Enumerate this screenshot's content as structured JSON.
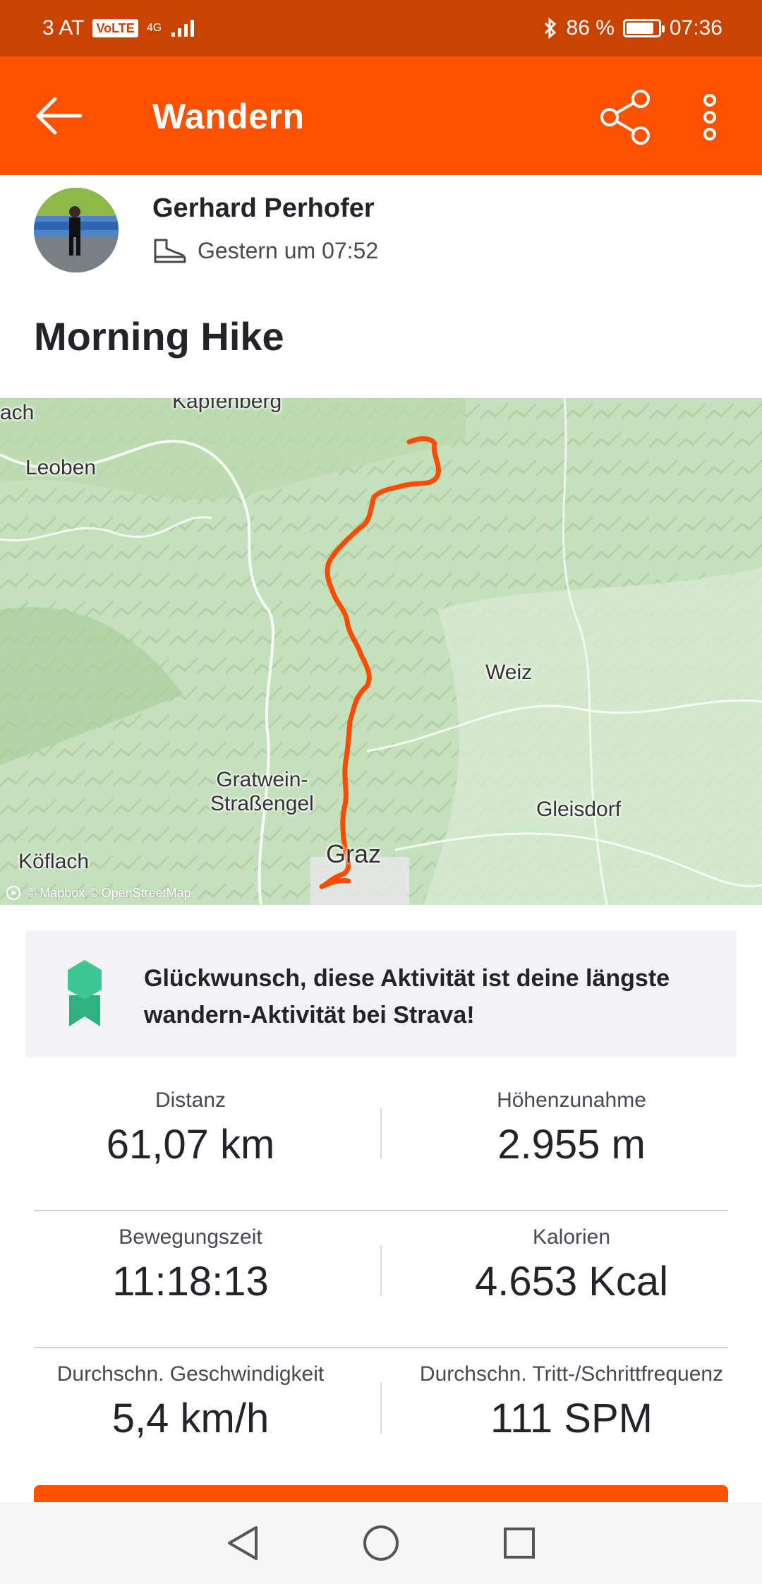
{
  "status_bar": {
    "carrier": "3 AT",
    "volte": "VoLTE",
    "network": "4G",
    "battery": "86 %",
    "battery_level": 0.86,
    "time": "07:36"
  },
  "app_bar": {
    "title": "Wandern",
    "icons": [
      "arrow-left-icon",
      "share-icon",
      "more-vertical-icon"
    ]
  },
  "athlete": {
    "name": "Gerhard Perhofer",
    "timestamp": "Gestern um 07:52",
    "sport_icon": "hiking-boot-icon"
  },
  "activity": {
    "title": "Morning Hike"
  },
  "map": {
    "labels": {
      "kapfenberg": "Kapfenberg",
      "ach": "ach",
      "leoben": "Leoben",
      "weiz": "Weiz",
      "gratwein": "Gratwein-\nStraßengel",
      "gleisdorf": "Gleisdorf",
      "koflach": "Köflach",
      "graz": "Graz"
    },
    "attribution": "© Mapbox © OpenStreetMap",
    "route_color": "#fc4c02"
  },
  "achievement": {
    "text": "Glückwunsch, diese Aktivität ist deine längste wandern-Aktivität bei Strava!",
    "icon": "award-badge-icon",
    "badge_color": "#3cc795"
  },
  "stats": {
    "distance": {
      "label": "Distanz",
      "value": "61,07 km"
    },
    "elevation": {
      "label": "Höhenzunahme",
      "value": "2.955 m"
    },
    "moving_time": {
      "label": "Bewegungszeit",
      "value": "11:18:13"
    },
    "calories": {
      "label": "Kalorien",
      "value": "4.653 Kcal"
    },
    "avg_speed": {
      "label": "Durchschn. Geschwindigkeit",
      "value": "5,4 km/h"
    },
    "avg_cadence": {
      "label": "Durchschn. Tritt-/Schrittfrequenz",
      "value": "111 SPM"
    }
  },
  "nav_bar": {
    "icons": [
      "nav-back-icon",
      "nav-home-icon",
      "nav-recents-icon"
    ]
  },
  "colors": {
    "brand": "#fc5200",
    "status_bar": "#c94300"
  }
}
